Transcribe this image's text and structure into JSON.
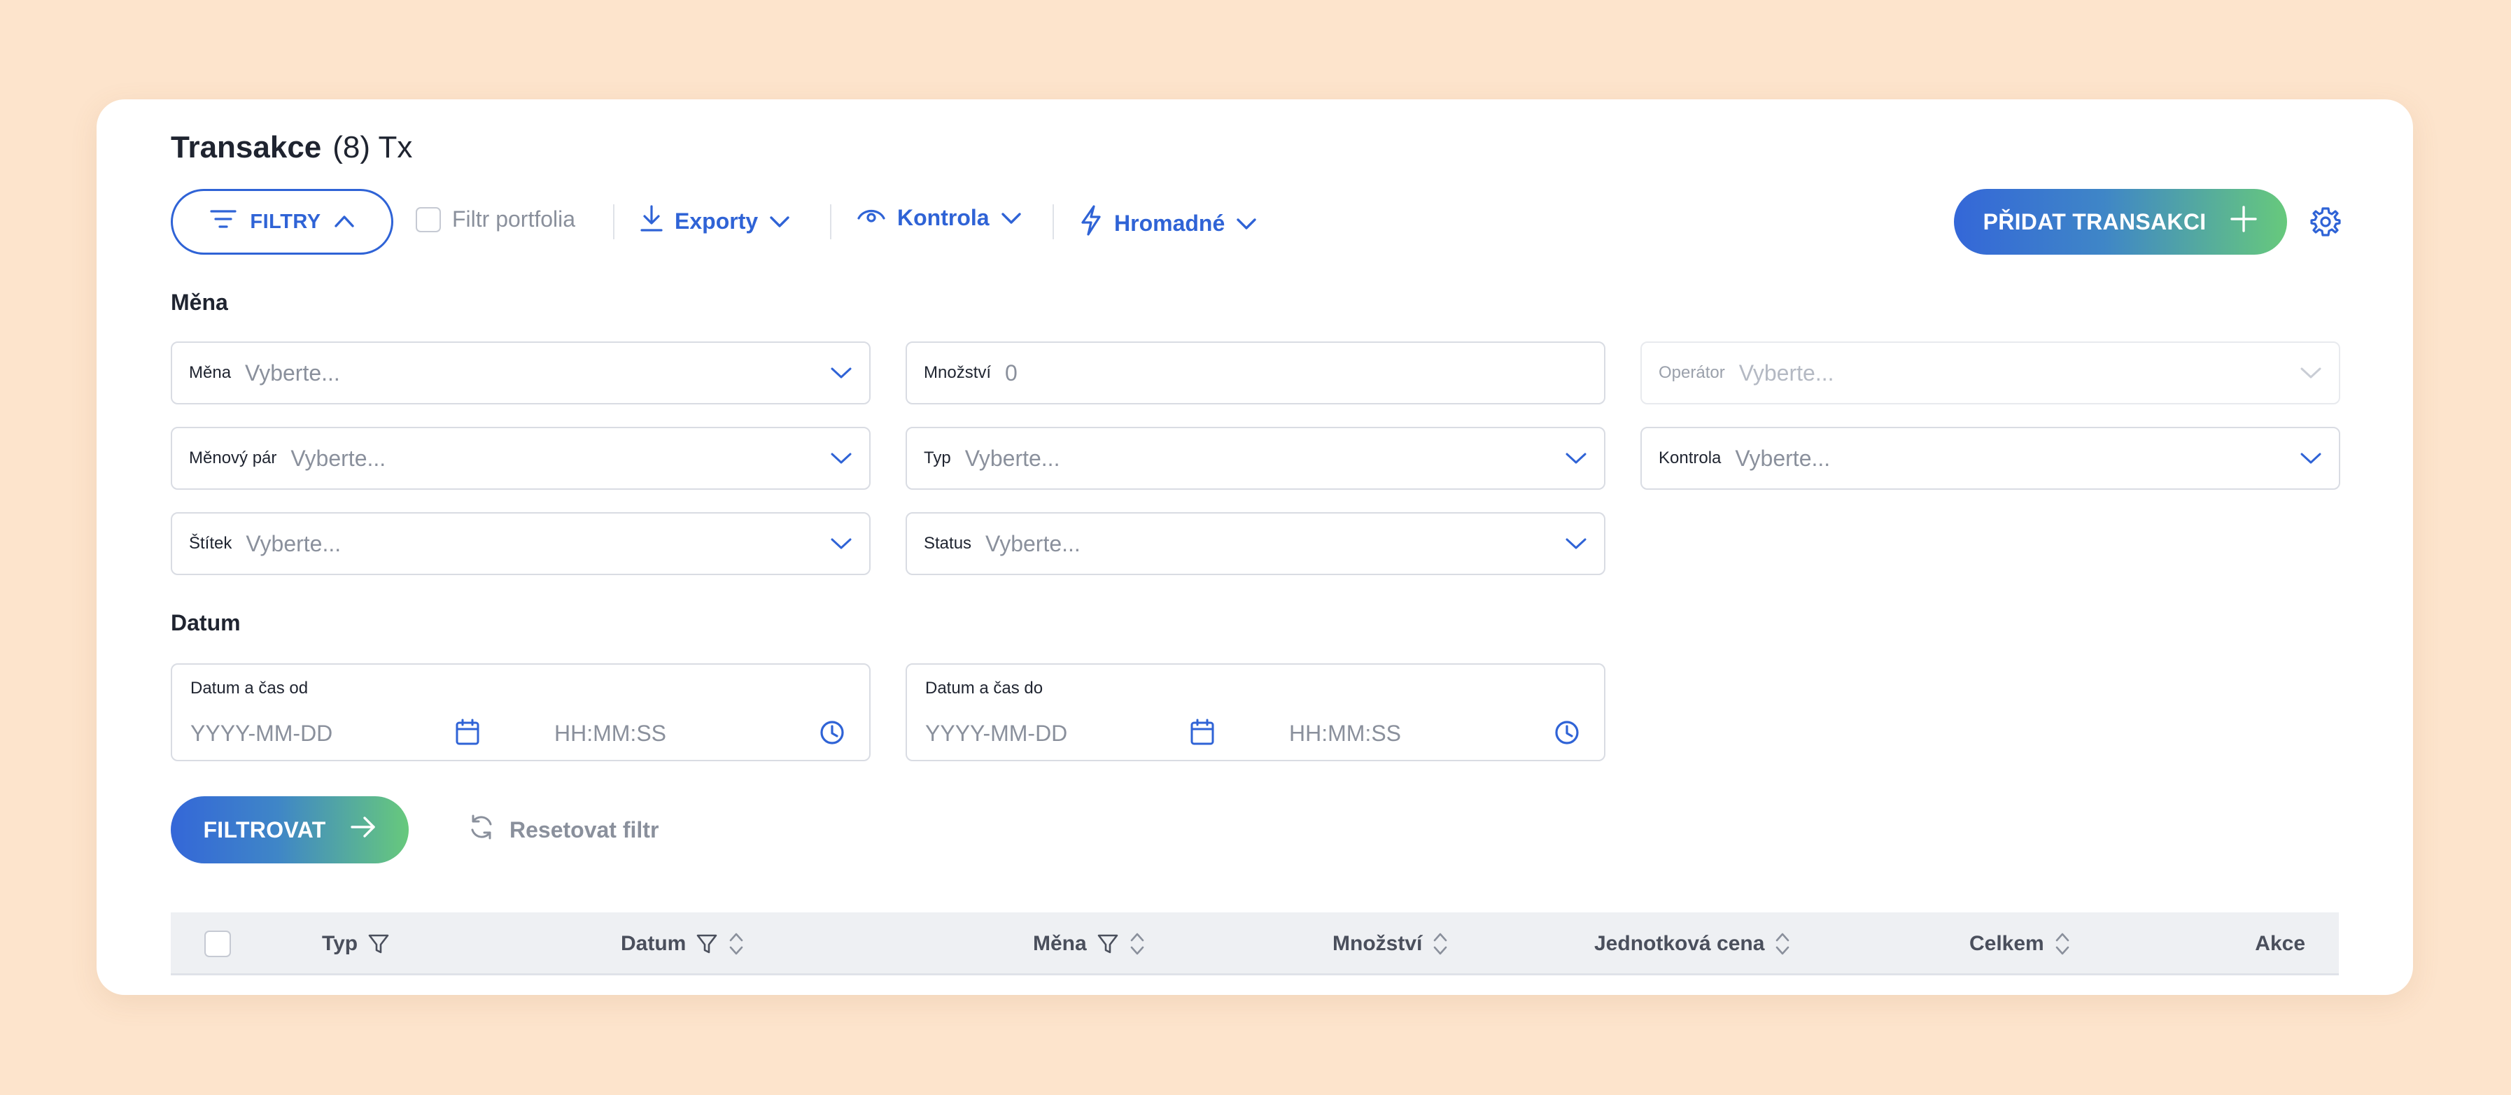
{
  "header": {
    "title": "Transakce",
    "count": "(8) Tx"
  },
  "toolbar": {
    "filters_label": "FILTRY",
    "portfolio_filter_label": "Filtr portfolia",
    "exports_label": "Exporty",
    "control_label": "Kontrola",
    "bulk_label": "Hromadné",
    "add_transaction_label": "PŘIDAT TRANSAKCI"
  },
  "currency_section": {
    "title": "Měna",
    "fields": {
      "currency": {
        "label": "Měna",
        "placeholder": "Vyberte..."
      },
      "quantity": {
        "label": "Množství",
        "value": "0"
      },
      "operator": {
        "label": "Operátor",
        "placeholder": "Vyberte..."
      },
      "currency_pair": {
        "label": "Měnový pár",
        "placeholder": "Vyberte..."
      },
      "type": {
        "label": "Typ",
        "placeholder": "Vyberte..."
      },
      "control": {
        "label": "Kontrola",
        "placeholder": "Vyberte..."
      },
      "tag": {
        "label": "Štítek",
        "placeholder": "Vyberte..."
      },
      "status": {
        "label": "Status",
        "placeholder": "Vyberte..."
      }
    }
  },
  "date_section": {
    "title": "Datum",
    "from": {
      "label": "Datum a čas od",
      "date_placeholder": "YYYY-MM-DD",
      "time_placeholder": "HH:MM:SS"
    },
    "to": {
      "label": "Datum a čas do",
      "date_placeholder": "YYYY-MM-DD",
      "time_placeholder": "HH:MM:SS"
    }
  },
  "actions": {
    "filter_label": "FILTROVAT",
    "reset_label": "Resetovat filtr"
  },
  "table": {
    "columns": {
      "type": "Typ",
      "date": "Datum",
      "currency": "Měna",
      "quantity": "Množství",
      "unit_price": "Jednotková cena",
      "total": "Celkem",
      "actions": "Akce"
    }
  },
  "colors": {
    "background": "#fde4cc",
    "accent": "#2f63d6",
    "gradient_start": "#3467d8",
    "gradient_end": "#67c97c",
    "muted_text": "#8a909c"
  },
  "icons": {
    "filters": "filter-lines-icon",
    "filters_toggle": "chevron-up-icon",
    "exports": "download-icon",
    "control": "eye-icon",
    "bulk": "lightning-icon",
    "add": "plus-icon",
    "settings": "gear-icon",
    "calendar": "calendar-icon",
    "clock": "clock-icon",
    "filter_submit": "arrow-right-icon",
    "reset": "refresh-icon",
    "column_filter": "funnel-icon",
    "column_sort": "sort-icon"
  }
}
